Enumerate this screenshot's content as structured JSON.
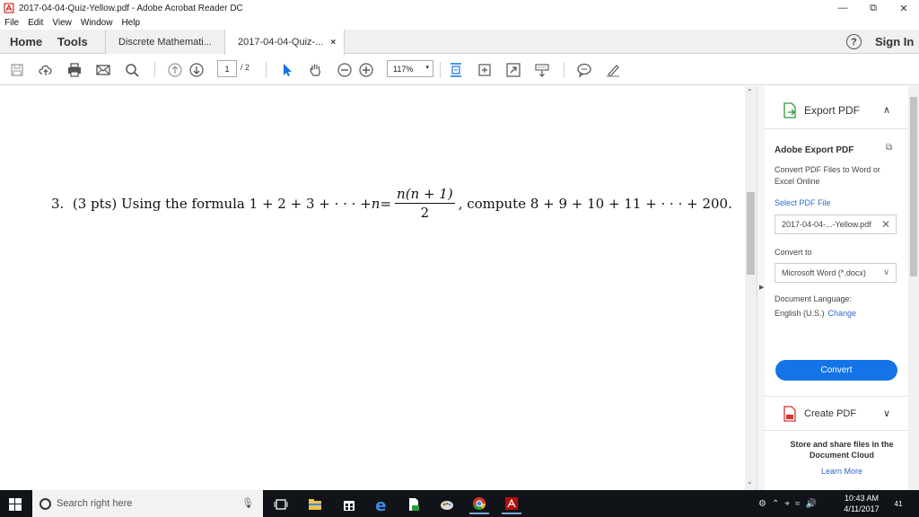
{
  "window": {
    "title": "2017-04-04-Quiz-Yellow.pdf - Adobe Acrobat Reader DC",
    "minimize": "—",
    "maximize": "⧉",
    "close": "✕"
  },
  "menu": [
    "File",
    "Edit",
    "View",
    "Window",
    "Help"
  ],
  "tabs": {
    "home": "Home",
    "tools": "Tools",
    "doc1": "Discrete Mathemati...",
    "doc2": "2017-04-04-Quiz-...",
    "close": "×"
  },
  "header_right": {
    "help": "?",
    "signin": "Sign In"
  },
  "toolbar": {
    "page_current": "1",
    "page_total": "/ 2",
    "zoom": "117%",
    "zoom_arrow": "▾"
  },
  "document": {
    "problem_num": "3.",
    "pts": "(3 pts)",
    "text1": "Using the formula",
    "formula_lhs": "1 + 2 + 3 + · · · + ",
    "n": "n",
    "eq": " =",
    "frac_num": "n(n + 1)",
    "frac_den": "2",
    "text2": ", compute 8 + 9 + 10 + 11 + · · · + 200."
  },
  "right_pane": {
    "export_title": "Export PDF",
    "export_chevron": "∧",
    "ae_title": "Adobe Export PDF",
    "ae_desc": "Convert PDF Files to Word or Excel Online",
    "select_label": "Select PDF File",
    "file_name": "2017-04-04-...-Yellow.pdf",
    "file_clear": "✕",
    "convert_to_label": "Convert to",
    "convert_to_value": "Microsoft Word (*.docx)",
    "convert_chevron": "∨",
    "lang_label": "Document Language:",
    "lang_value": "English (U.S.)",
    "lang_change": "Change",
    "convert_button": "Convert",
    "create_title": "Create PDF",
    "create_chevron": "∨",
    "cloud_text": "Store and share files in the Document Cloud",
    "learn_more": "Learn More"
  },
  "taskbar": {
    "search_placeholder": "Search right here",
    "time": "10:43 AM",
    "date": "4/11/2017",
    "notif_count": "41"
  },
  "colors": {
    "accent": "#1473e6",
    "link": "#2a6ad0",
    "taskbar": "#101418"
  }
}
